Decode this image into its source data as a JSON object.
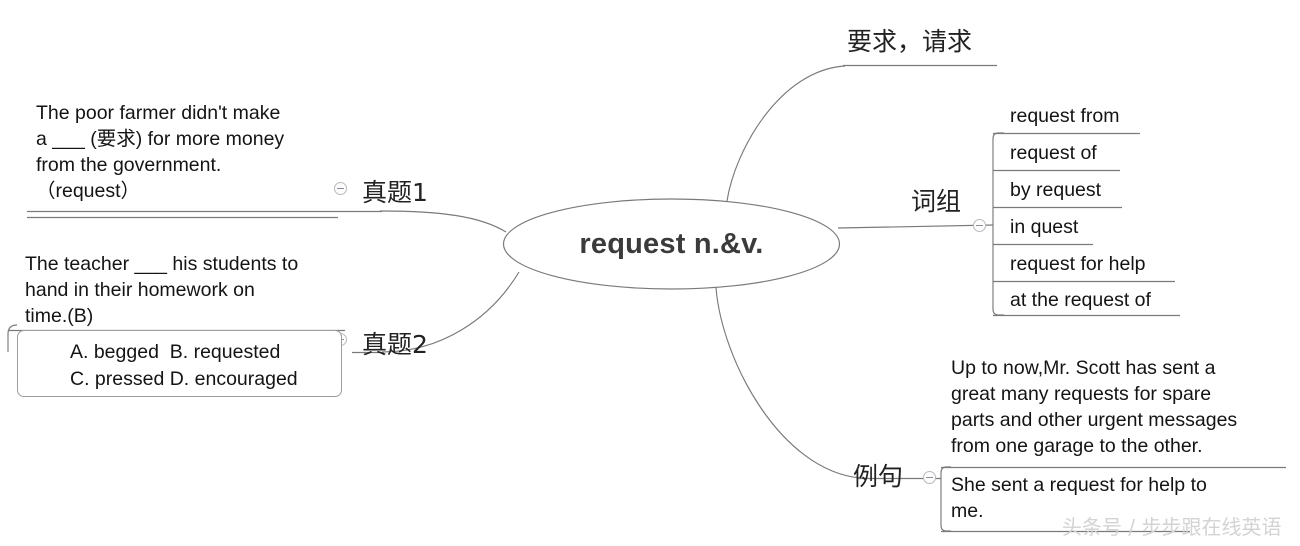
{
  "diagram": {
    "type": "mind-map",
    "center": {
      "label": "request n.&v.",
      "shape": "ellipse"
    },
    "line_color": "#7a7a7a",
    "text_color": "#141414",
    "center_text_color": "#3b3b3b",
    "branches": [
      {
        "id": "meaning",
        "label": "要求，请求",
        "position": "top",
        "children": []
      },
      {
        "id": "phrases",
        "label": "词组",
        "position": "right",
        "collapse_icon": "collapse-minus-icon",
        "children": [
          {
            "text": "request from"
          },
          {
            "text": "request of"
          },
          {
            "text": "by request"
          },
          {
            "text": "in quest"
          },
          {
            "text": "request for help"
          },
          {
            "text": "at the request of"
          }
        ]
      },
      {
        "id": "examples",
        "label": "例句",
        "position": "bottom-right",
        "collapse_icon": "collapse-minus-icon",
        "children": [
          {
            "text": "Up to now,Mr. Scott has sent a\ngreat many requests for spare\nparts and other urgent messages\nfrom one garage to the other."
          },
          {
            "text": "She sent a request for help to\nme."
          }
        ]
      },
      {
        "id": "exam-1",
        "label": "真题1",
        "position": "left-top",
        "collapse_icon": "collapse-minus-icon",
        "children": [
          {
            "text": "The poor farmer didn't make\na ___ (要求) for more money\nfrom the government.\n（request）"
          }
        ]
      },
      {
        "id": "exam-2",
        "label": "真题2",
        "position": "left-bottom",
        "collapse_icon": "collapse-minus-icon",
        "children": [
          {
            "text": "The teacher ___ his students to\nhand in their homework on\ntime.(B)"
          },
          {
            "boxed": true,
            "options": "A. begged  B. requested\nC. pressed D. encouraged"
          }
        ]
      }
    ]
  },
  "watermark": {
    "text": "头条号 / 步步跟在线英语"
  }
}
